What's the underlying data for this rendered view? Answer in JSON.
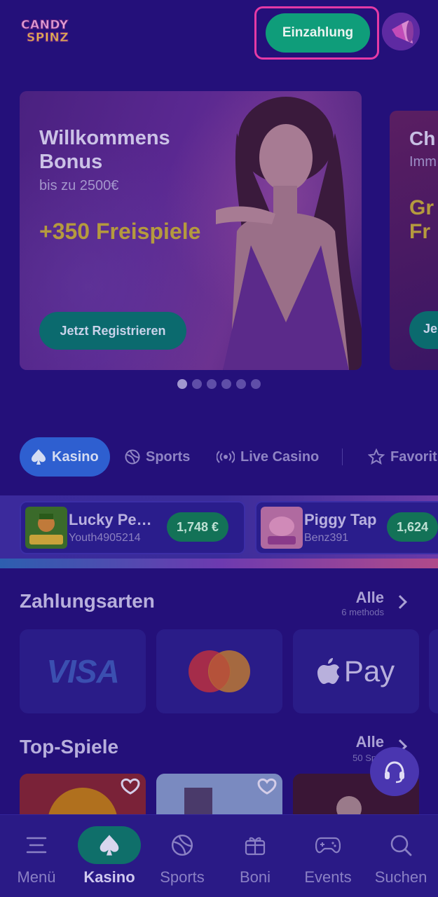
{
  "header": {
    "logo_line1": "CANDY",
    "logo_line2": "SPINZ",
    "deposit_label": "Einzahlung"
  },
  "banners": [
    {
      "title": "Willkommens Bonus",
      "subtitle": "bis zu 2500€",
      "highlight": "+350 Freispiele",
      "cta": "Jetzt Registrieren"
    },
    {
      "title": "Ch",
      "subtitle": "Imm",
      "highlight": "Gr Fr",
      "cta": "Je"
    }
  ],
  "carousel": {
    "count": 6,
    "active_index": 0
  },
  "category_tabs": [
    {
      "label": "Kasino",
      "icon": "spade-icon",
      "active": true
    },
    {
      "label": "Sports",
      "icon": "ball-icon",
      "active": false
    },
    {
      "label": "Live Casino",
      "icon": "live-icon",
      "active": false
    },
    {
      "label": "Favorit",
      "icon": "star-icon",
      "active": false
    }
  ],
  "winners": [
    {
      "game": "Lucky Pe…",
      "user": "Youth4905214",
      "amount": "1,748 €"
    },
    {
      "game": "Piggy Tap",
      "user": "Benz391",
      "amount": "1,624"
    }
  ],
  "payments": {
    "title": "Zahlungsarten",
    "all_label": "Alle",
    "count_label": "6 methods",
    "methods": [
      "VISA",
      "Mastercard",
      "Pay"
    ]
  },
  "top_games": {
    "title": "Top-Spiele",
    "all_label": "Alle",
    "count_label": "50 Spi"
  },
  "bottom_nav": [
    {
      "label": "Menü",
      "icon": "menu-icon",
      "active": false
    },
    {
      "label": "Kasino",
      "icon": "spade-icon",
      "active": true
    },
    {
      "label": "Sports",
      "icon": "ball-icon",
      "active": false
    },
    {
      "label": "Boni",
      "icon": "gift-icon",
      "active": false
    },
    {
      "label": "Events",
      "icon": "gamepad-icon",
      "active": false
    },
    {
      "label": "Suchen",
      "icon": "search-icon",
      "active": false
    }
  ],
  "colors": {
    "background": "#24107a",
    "deposit_button": "#0f9d7a",
    "highlight_outline": "#e53aa6",
    "active_tab": "#2e5fd0",
    "active_nav": "#0f6f6a",
    "gold": "#b59a3e"
  }
}
